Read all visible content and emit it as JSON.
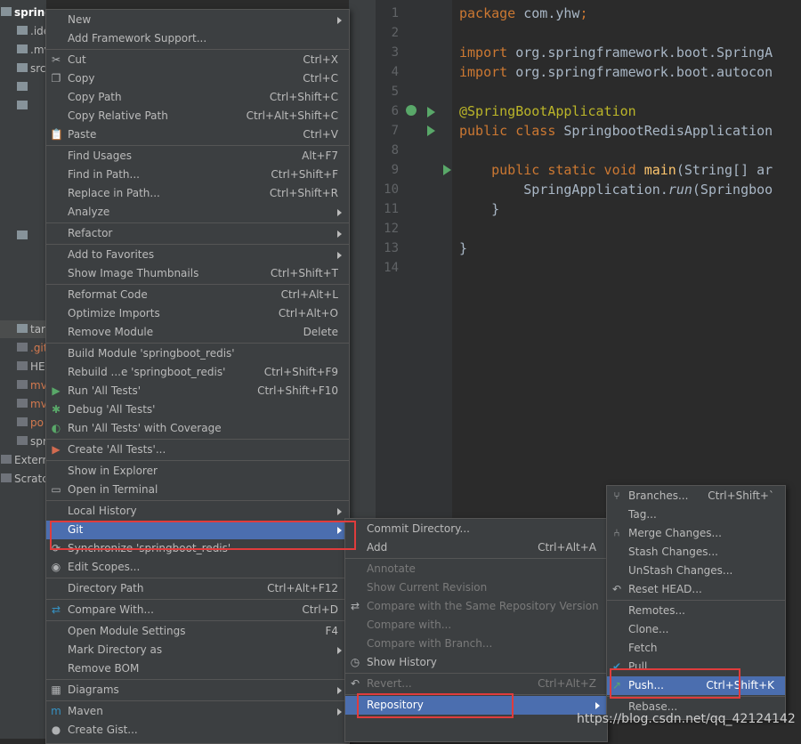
{
  "project_tree": {
    "rows": [
      {
        "label": "springbo",
        "color": "#ffffff",
        "bold": true
      },
      {
        "label": ".ide",
        "color": "#bbbbbb"
      },
      {
        "label": ".mv",
        "color": "#bbbbbb"
      },
      {
        "label": "src",
        "color": "#bbbbbb"
      },
      {
        "label": "",
        "color": "#bbbbbb"
      },
      {
        "label": "",
        "color": "#bbbbbb"
      },
      {
        "label": "",
        "color": "#bbbbbb"
      },
      {
        "label": "tar",
        "color": "#bbbbbb"
      },
      {
        "label": ".git",
        "color": "#d47a4f"
      },
      {
        "label": "HE",
        "color": "#bbbbbb"
      },
      {
        "label": "mv",
        "color": "#d47a4f"
      },
      {
        "label": "mv",
        "color": "#d47a4f"
      },
      {
        "label": "po",
        "color": "#d47a4f"
      },
      {
        "label": "spr",
        "color": "#bbbbbb"
      },
      {
        "label": "Extern",
        "color": "#bbbbbb"
      },
      {
        "label": "Scratc",
        "color": "#bbbbbb"
      }
    ]
  },
  "editor": {
    "line_numbers": [
      "1",
      "2",
      "3",
      "4",
      "5",
      "6",
      "7",
      "8",
      "9",
      "10",
      "11",
      "12",
      "13",
      "14"
    ],
    "lines": [
      [
        {
          "t": "package ",
          "c": "kw"
        },
        {
          "t": "com.yhw",
          "c": ""
        },
        {
          "t": ";",
          "c": "kw"
        }
      ],
      [],
      [
        {
          "t": "import ",
          "c": "kw"
        },
        {
          "t": "org.springframework.boot.SpringA",
          "c": ""
        }
      ],
      [
        {
          "t": "import ",
          "c": "kw"
        },
        {
          "t": "org.springframework.boot.autocon",
          "c": ""
        }
      ],
      [],
      [
        {
          "t": "@SpringBootApplication",
          "c": "ann"
        }
      ],
      [
        {
          "t": "public class ",
          "c": "kw"
        },
        {
          "t": "SpringbootRedisApplication",
          "c": ""
        }
      ],
      [],
      [
        {
          "t": "    public static void ",
          "c": "kw"
        },
        {
          "t": "main",
          "c": "fn"
        },
        {
          "t": "(String[] ar",
          "c": ""
        }
      ],
      [
        {
          "t": "        SpringApplication.",
          "c": ""
        },
        {
          "t": "run",
          "c": "it"
        },
        {
          "t": "(Springboo",
          "c": ""
        }
      ],
      [
        {
          "t": "    }",
          "c": ""
        }
      ],
      [],
      [
        {
          "t": "}",
          "c": ""
        }
      ],
      []
    ]
  },
  "main_menu": {
    "items": [
      {
        "label": "New",
        "shortcut": "",
        "submenu": true,
        "icon": ""
      },
      {
        "label": "Add Framework Support...",
        "shortcut": "",
        "icon": ""
      },
      {
        "sep": true
      },
      {
        "label": "Cut",
        "shortcut": "Ctrl+X",
        "icon": "scissors-icon",
        "glyph": "✂"
      },
      {
        "label": "Copy",
        "shortcut": "Ctrl+C",
        "icon": "copy-icon",
        "glyph": "❐"
      },
      {
        "label": "Copy Path",
        "shortcut": "Ctrl+Shift+C",
        "icon": ""
      },
      {
        "label": "Copy Relative Path",
        "shortcut": "Ctrl+Alt+Shift+C",
        "icon": ""
      },
      {
        "label": "Paste",
        "shortcut": "Ctrl+V",
        "icon": "paste-icon",
        "glyph": "📋"
      },
      {
        "sep": true
      },
      {
        "label": "Find Usages",
        "shortcut": "Alt+F7",
        "icon": ""
      },
      {
        "label": "Find in Path...",
        "shortcut": "Ctrl+Shift+F",
        "icon": ""
      },
      {
        "label": "Replace in Path...",
        "shortcut": "Ctrl+Shift+R",
        "icon": ""
      },
      {
        "label": "Analyze",
        "shortcut": "",
        "submenu": true,
        "icon": ""
      },
      {
        "sep": true
      },
      {
        "label": "Refactor",
        "shortcut": "",
        "submenu": true,
        "icon": ""
      },
      {
        "sep": true
      },
      {
        "label": "Add to Favorites",
        "shortcut": "",
        "submenu": true,
        "icon": ""
      },
      {
        "label": "Show Image Thumbnails",
        "shortcut": "Ctrl+Shift+T",
        "icon": ""
      },
      {
        "sep": true
      },
      {
        "label": "Reformat Code",
        "shortcut": "Ctrl+Alt+L",
        "icon": ""
      },
      {
        "label": "Optimize Imports",
        "shortcut": "Ctrl+Alt+O",
        "icon": ""
      },
      {
        "label": "Remove Module",
        "shortcut": "Delete",
        "icon": ""
      },
      {
        "sep": true
      },
      {
        "label": "Build Module 'springboot_redis'",
        "shortcut": "",
        "icon": ""
      },
      {
        "label": "Rebuild ...e 'springboot_redis'",
        "shortcut": "Ctrl+Shift+F9",
        "icon": ""
      },
      {
        "label": "Run 'All Tests'",
        "shortcut": "Ctrl+Shift+F10",
        "icon": "run-icon",
        "glyph": "▶",
        "glyphColor": "#59a869"
      },
      {
        "label": "Debug 'All Tests'",
        "shortcut": "",
        "icon": "debug-icon",
        "glyph": "✱",
        "glyphColor": "#59a869"
      },
      {
        "label": "Run 'All Tests' with Coverage",
        "shortcut": "",
        "icon": "coverage-icon",
        "glyph": "◐",
        "glyphColor": "#59a869"
      },
      {
        "sep": true
      },
      {
        "label": "Create 'All Tests'...",
        "shortcut": "",
        "icon": "create-test-icon",
        "glyph": "▶",
        "glyphColor": "#d26b50"
      },
      {
        "sep": true
      },
      {
        "label": "Show in Explorer",
        "shortcut": "",
        "icon": ""
      },
      {
        "label": "Open in Terminal",
        "shortcut": "",
        "icon": "terminal-icon",
        "glyph": "▭"
      },
      {
        "sep": true
      },
      {
        "label": "Local History",
        "shortcut": "",
        "submenu": true,
        "icon": ""
      },
      {
        "label": "Git",
        "shortcut": "",
        "submenu": true,
        "icon": "",
        "selected": true
      },
      {
        "label": "Synchronize 'springboot_redis'",
        "shortcut": "",
        "icon": "sync-icon",
        "glyph": "⟳"
      },
      {
        "label": "Edit Scopes...",
        "shortcut": "",
        "icon": "scopes-icon",
        "glyph": "◉"
      },
      {
        "sep": true
      },
      {
        "label": "Directory Path",
        "shortcut": "Ctrl+Alt+F12",
        "icon": ""
      },
      {
        "sep": true
      },
      {
        "label": "Compare With...",
        "shortcut": "Ctrl+D",
        "icon": "compare-icon",
        "glyph": "⇄",
        "glyphColor": "#3592c4"
      },
      {
        "sep": true
      },
      {
        "label": "Open Module Settings",
        "shortcut": "F4",
        "icon": ""
      },
      {
        "label": "Mark Directory as",
        "shortcut": "",
        "submenu": true,
        "icon": ""
      },
      {
        "label": "Remove BOM",
        "shortcut": "",
        "icon": ""
      },
      {
        "sep": true
      },
      {
        "label": "Diagrams",
        "shortcut": "",
        "submenu": true,
        "icon": "diagram-icon",
        "glyph": "▦"
      },
      {
        "sep": true
      },
      {
        "label": "Maven",
        "shortcut": "",
        "submenu": true,
        "icon": "maven-icon",
        "glyph": "m",
        "glyphColor": "#3592c4"
      },
      {
        "label": "Create Gist...",
        "shortcut": "",
        "icon": "github-icon",
        "glyph": "●"
      }
    ]
  },
  "git_menu": {
    "items": [
      {
        "label": "Commit Directory...",
        "shortcut": "",
        "icon": ""
      },
      {
        "label": "Add",
        "shortcut": "Ctrl+Alt+A",
        "icon": ""
      },
      {
        "sep": true
      },
      {
        "label": "Annotate",
        "shortcut": "",
        "disabled": true,
        "icon": ""
      },
      {
        "label": "Show Current Revision",
        "shortcut": "",
        "disabled": true,
        "icon": ""
      },
      {
        "label": "Compare with the Same Repository Version",
        "shortcut": "",
        "disabled": true,
        "icon": "compare-same-icon",
        "glyph": "⇄"
      },
      {
        "label": "Compare with...",
        "shortcut": "",
        "disabled": true,
        "icon": ""
      },
      {
        "label": "Compare with Branch...",
        "shortcut": "",
        "disabled": true,
        "icon": ""
      },
      {
        "label": "Show History",
        "shortcut": "",
        "icon": "history-icon",
        "glyph": "◷"
      },
      {
        "sep": true
      },
      {
        "label": "Revert...",
        "shortcut": "Ctrl+Alt+Z",
        "disabled": true,
        "icon": "revert-icon",
        "glyph": "↶"
      },
      {
        "sep": true
      },
      {
        "label": "Repository",
        "shortcut": "",
        "submenu": true,
        "selected": true,
        "icon": ""
      }
    ]
  },
  "repo_menu": {
    "items": [
      {
        "label": "Branches...",
        "shortcut": "Ctrl+Shift+`",
        "icon": "branch-icon",
        "glyph": "⑂"
      },
      {
        "label": "Tag...",
        "shortcut": "",
        "icon": ""
      },
      {
        "label": "Merge Changes...",
        "shortcut": "",
        "icon": "merge-icon",
        "glyph": "⑃"
      },
      {
        "label": "Stash Changes...",
        "shortcut": "",
        "icon": ""
      },
      {
        "label": "UnStash Changes...",
        "shortcut": "",
        "icon": ""
      },
      {
        "label": "Reset HEAD...",
        "shortcut": "",
        "icon": "reset-icon",
        "glyph": "↶"
      },
      {
        "sep": true
      },
      {
        "label": "Remotes...",
        "shortcut": "",
        "icon": ""
      },
      {
        "label": "Clone...",
        "shortcut": "",
        "icon": ""
      },
      {
        "label": "Fetch",
        "shortcut": "",
        "icon": ""
      },
      {
        "label": "Pull",
        "shortcut": "",
        "icon": "pull-icon",
        "glyph": "✔",
        "glyphColor": "#3592c4"
      },
      {
        "label": "Push...",
        "shortcut": "Ctrl+Shift+K",
        "selected": true,
        "icon": "push-icon",
        "glyph": "↗",
        "glyphColor": "#59a869"
      },
      {
        "sep": true
      },
      {
        "label": "Rebase...",
        "shortcut": "",
        "icon": ""
      }
    ]
  },
  "watermark": "https://blog.csdn.net/qq_42124142"
}
